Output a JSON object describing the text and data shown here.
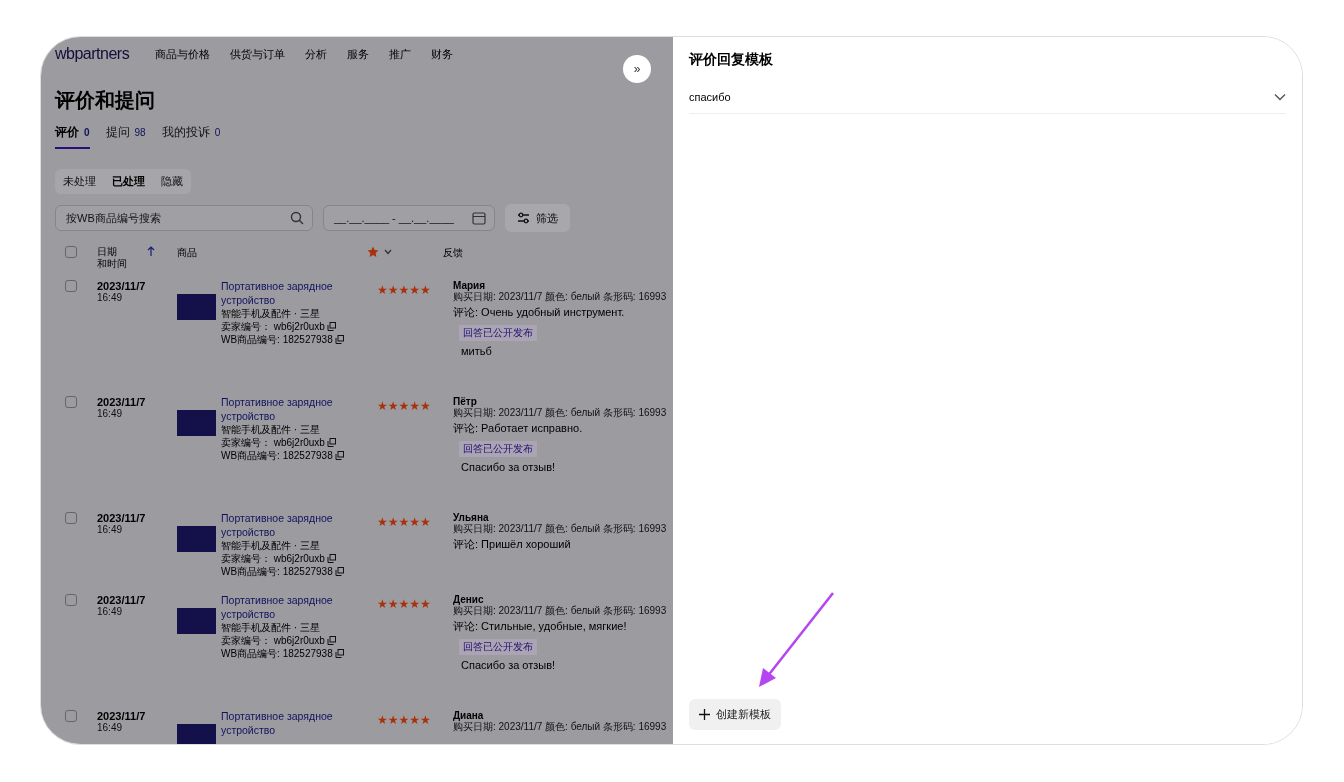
{
  "nav": {
    "logo": "wbpartners",
    "items": [
      "商品与价格",
      "供货与订单",
      "分析",
      "服务",
      "推广",
      "财务"
    ],
    "collapse": "»"
  },
  "page_title": "评价和提问",
  "tabs": [
    {
      "label": "评价",
      "count": "0",
      "selected": true
    },
    {
      "label": "提问",
      "count": "98",
      "selected": false
    },
    {
      "label": "我的投诉",
      "count": "0",
      "selected": false
    }
  ],
  "segments": [
    {
      "label": "未处理",
      "selected": false
    },
    {
      "label": "已处理",
      "selected": true
    },
    {
      "label": "隐藏",
      "selected": false
    }
  ],
  "search": {
    "placeholder": "按WB商品编号搜索"
  },
  "date_range": {
    "placeholder": "__.__.____ - __.__.____"
  },
  "filter_button": "筛选",
  "table": {
    "date_column": [
      "日期",
      "和时间"
    ],
    "columns": [
      "商品",
      "反馈"
    ],
    "select_all_checked": false,
    "rows": [
      {
        "checked": false,
        "date": "2023/11/7",
        "time": "16:49",
        "product": "Портативное зарядное устройство",
        "category": "智能手机及配件 · 三星",
        "seller_code": "卖家编号：  wb6j2r0uxb",
        "wb_code": "WB商品编号: 182527938",
        "stars": 5,
        "name": "Мария",
        "meta": "购买日期: 2023/11/7   颜色: белый   条形码: 16993",
        "comment": "评论: Очень удобный инструмент.",
        "reply_badge": "回答已公开发布",
        "reply": "митьб"
      },
      {
        "checked": false,
        "date": "2023/11/7",
        "time": "16:49",
        "product": "Портативное зарядное устройство",
        "category": "智能手机及配件 · 三星",
        "seller_code": "卖家编号：  wb6j2r0uxb",
        "wb_code": "WB商品编号: 182527938",
        "stars": 5,
        "name": "Пётр",
        "meta": "购买日期: 2023/11/7   颜色: белый   条形码: 16993",
        "comment": "评论: Работает исправно.",
        "reply_badge": "回答已公开发布",
        "reply": "Спасибо за отзыв!"
      },
      {
        "checked": false,
        "date": "2023/11/7",
        "time": "16:49",
        "product": "Портативное зарядное устройство",
        "category": "智能手机及配件 · 三星",
        "seller_code": "卖家编号：  wb6j2r0uxb",
        "wb_code": "WB商品编号: 182527938",
        "stars": 5,
        "name": "Ульяна",
        "meta": "购买日期: 2023/11/7   颜色: белый   条形码: 16993",
        "comment": "评论: Пришёл хороший"
      },
      {
        "checked": false,
        "date": "2023/11/7",
        "time": "16:49",
        "product": "Портативное зарядное устройство",
        "category": "智能手机及配件 · 三星",
        "seller_code": "卖家编号：  wb6j2r0uxb",
        "wb_code": "WB商品编号: 182527938",
        "stars": 5,
        "name": "Денис",
        "meta": "购买日期: 2023/11/7   颜色: белый   条形码: 16993",
        "comment": "评论: Стильные, удобные, мягкие!",
        "reply_badge": "回答已公开发布",
        "reply": "Спасибо за отзыв!"
      },
      {
        "checked": false,
        "date": "2023/11/7",
        "time": "16:49",
        "product": "Портативное зарядное устройство",
        "stars": 5,
        "name": "Диана",
        "meta": "购买日期: 2023/11/7   颜色: белый   条形码: 16993"
      }
    ]
  },
  "drawer": {
    "title": "评价回复模板",
    "templates": [
      {
        "label": "спасибо",
        "expanded": false
      }
    ],
    "create_button": "创建新模板"
  }
}
